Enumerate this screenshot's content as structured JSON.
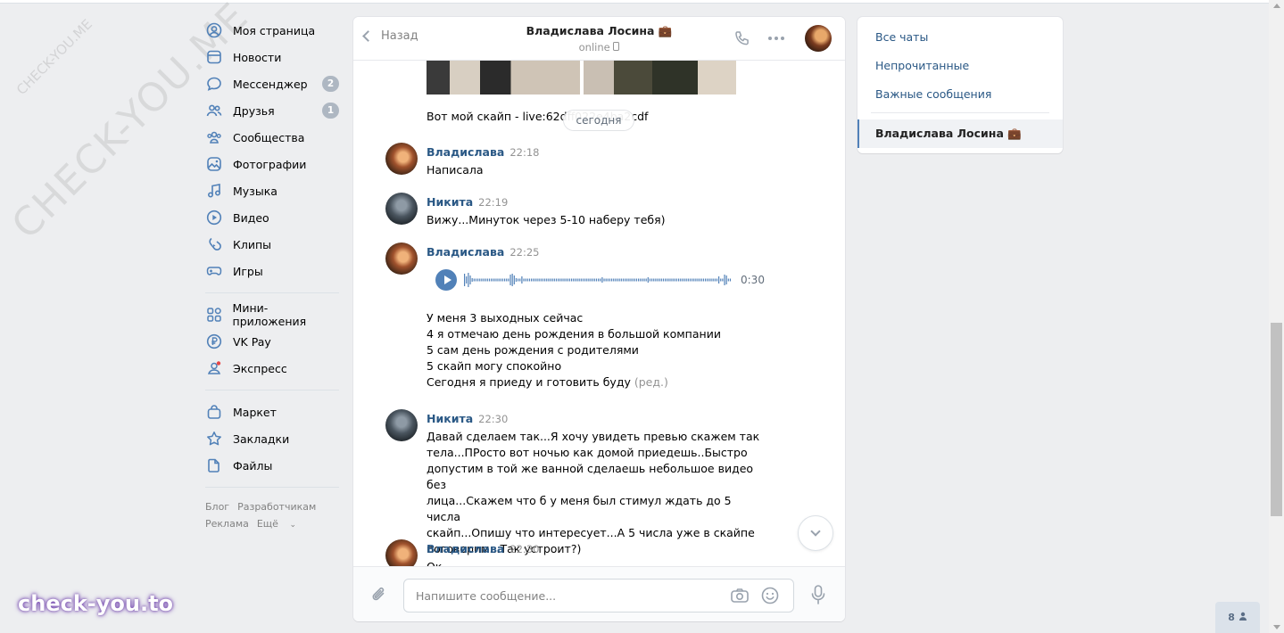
{
  "watermark": {
    "big": "CHECK-YOU.ME",
    "small": "CHECK-YOU.ME",
    "brand": "check-you.to"
  },
  "sidebar": {
    "items": [
      {
        "label": "Моя страница",
        "icon": "user-circle-icon"
      },
      {
        "label": "Новости",
        "icon": "news-icon"
      },
      {
        "label": "Мессенджер",
        "icon": "message-icon",
        "badge": "2"
      },
      {
        "label": "Друзья",
        "icon": "friends-icon",
        "badge": "1"
      },
      {
        "label": "Сообщества",
        "icon": "communities-icon"
      },
      {
        "label": "Фотографии",
        "icon": "photo-icon"
      },
      {
        "label": "Музыка",
        "icon": "music-icon"
      },
      {
        "label": "Видео",
        "icon": "video-icon"
      },
      {
        "label": "Клипы",
        "icon": "clips-icon"
      },
      {
        "label": "Игры",
        "icon": "gamepad-icon"
      }
    ],
    "items2": [
      {
        "label": "Мини-приложения",
        "icon": "apps-icon"
      },
      {
        "label": "VK Pay",
        "icon": "ruble-icon"
      },
      {
        "label": "Экспресс",
        "icon": "express-icon"
      }
    ],
    "items3": [
      {
        "label": "Маркет",
        "icon": "bag-icon"
      },
      {
        "label": "Закладки",
        "icon": "star-icon"
      },
      {
        "label": "Файлы",
        "icon": "file-icon"
      }
    ],
    "footer": [
      "Блог",
      "Разработчикам",
      "Реклама",
      "Ещё"
    ]
  },
  "chat": {
    "back_label": "Назад",
    "peer_name": "Владислава Лосина 💼",
    "peer_status": "online",
    "date_pill": "сегодня",
    "skype_text": "Вот мой скайп - live:62dff022e4ba2cdf",
    "messages": [
      {
        "author": "Владислава",
        "time": "22:18",
        "text": "Написала"
      },
      {
        "author": "Никита",
        "time": "22:19",
        "text": "Вижу...Минуток через 5-10 наберу тебя)"
      },
      {
        "author": "Владислава",
        "time": "22:25",
        "voice_duration": "0:30",
        "lines": [
          "У меня 3 выходных сейчас",
          "4 я отмечаю день рождения в большой компании",
          "5 сам день рождения с родителями",
          "5 скайп могу спокойно",
          "Сегодня я приеду и готовить буду"
        ],
        "edited": "(ред.)"
      },
      {
        "author": "Никита",
        "time": "22:30",
        "lines": [
          "Давай сделаем так...Я хочу увидеть превью скажем так",
          "тела...ПРосто вот ночью как домой приедешь..Быстро",
          "допустим в той же ванной сделаешь небольшое видео без",
          "лица...Скажем что б у меня был стимул ждать до 5 числа",
          "скайп...Опишу что интересует...А 5 числа уже в скайпе",
          "поговорим...Так устроит?)"
        ]
      },
      {
        "author": "Владислава",
        "time": "22:30",
        "text": "Ок"
      }
    ],
    "input_placeholder": "Напишите сообщение..."
  },
  "right_panel": {
    "filters": [
      "Все чаты",
      "Непрочитанные",
      "Важные сообщения"
    ],
    "active_chat": "Владислава Лосина 💼"
  },
  "counter": "8",
  "colors": {
    "link": "#2a5885",
    "accent": "#5181b8",
    "bg": "#edeef0"
  }
}
